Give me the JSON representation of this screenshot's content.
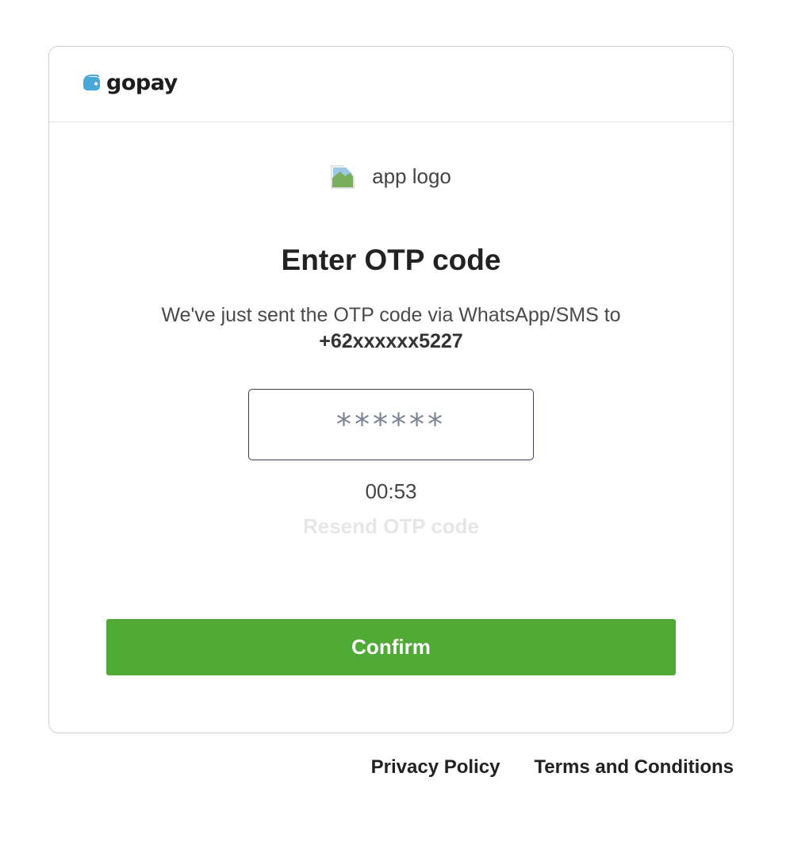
{
  "brand": {
    "name": "gopay",
    "icon": "wallet-icon",
    "icon_color": "#4aa8d8"
  },
  "app_logo": {
    "alt": "app logo",
    "icon": "broken-image-icon"
  },
  "otp": {
    "title": "Enter OTP code",
    "message": "We've just sent the OTP code via WhatsApp/SMS to",
    "phone": "+62xxxxxx5227",
    "placeholder": "******",
    "timer": "00:53",
    "resend_label": "Resend OTP code",
    "confirm_label": "Confirm"
  },
  "footer": {
    "privacy": "Privacy Policy",
    "terms": "Terms and Conditions"
  },
  "colors": {
    "confirm_bg": "#4fa934",
    "resend_disabled": "#e6e6e6"
  }
}
